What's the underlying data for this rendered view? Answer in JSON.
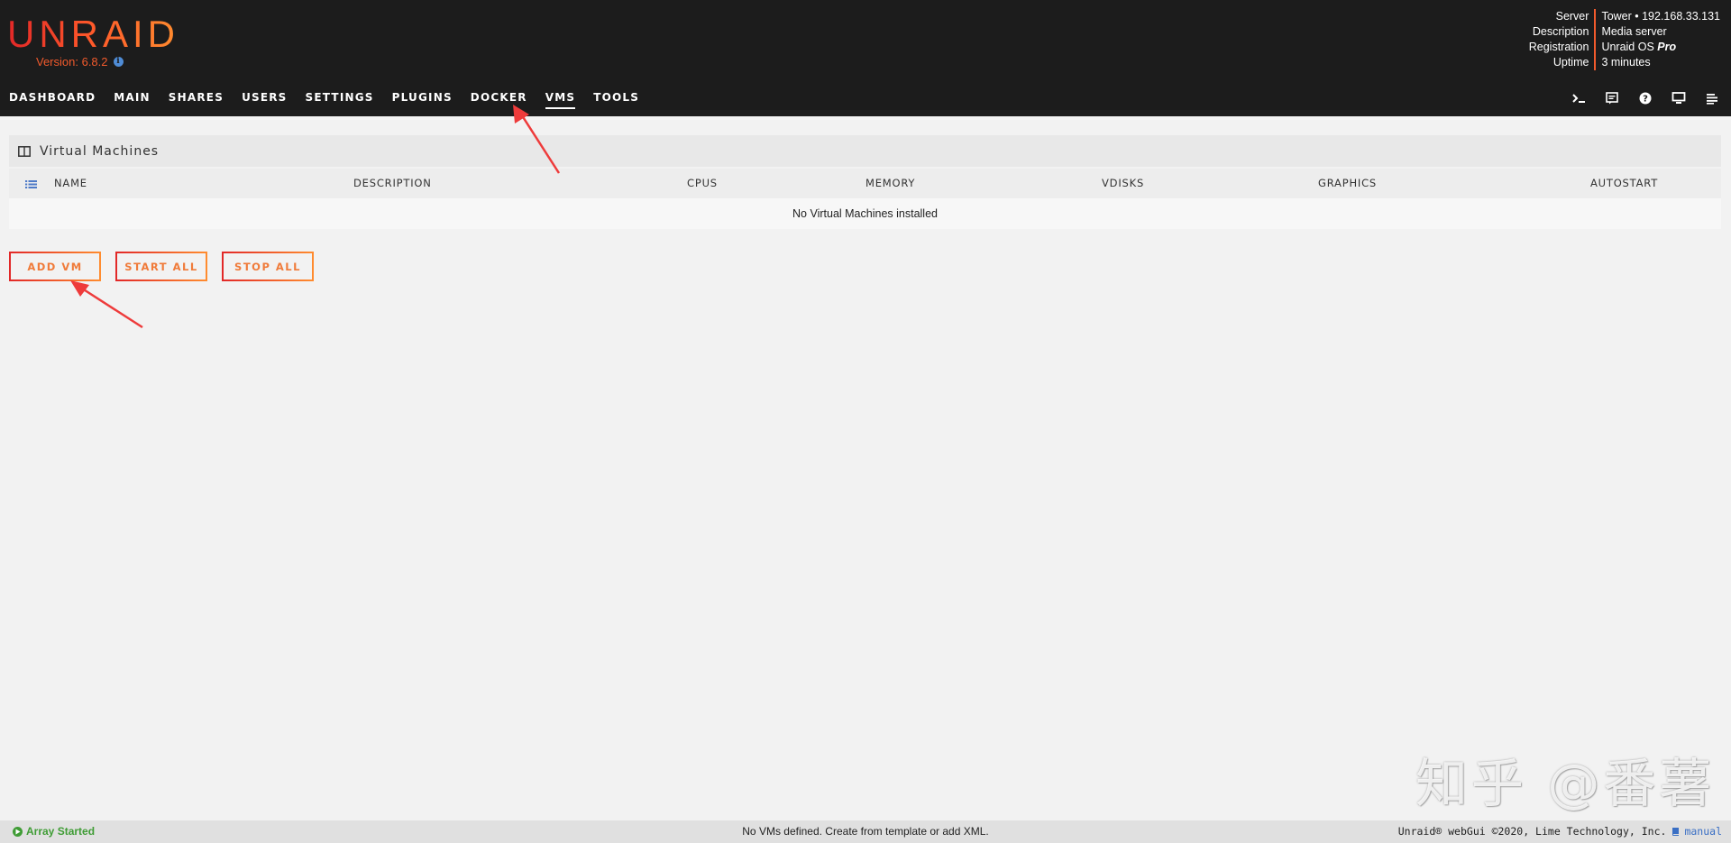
{
  "header": {
    "logo": "UNRAID",
    "version": "Version: 6.8.2",
    "server_info": [
      {
        "label": "Server",
        "value": "Tower • 192.168.33.131"
      },
      {
        "label": "Description",
        "value": "Media server"
      },
      {
        "label": "Registration",
        "value_plain": "Unraid OS ",
        "value_em": "Pro"
      },
      {
        "label": "Uptime",
        "value": "3 minutes"
      }
    ],
    "nav": [
      {
        "label": "DASHBOARD"
      },
      {
        "label": "MAIN"
      },
      {
        "label": "SHARES"
      },
      {
        "label": "USERS"
      },
      {
        "label": "SETTINGS"
      },
      {
        "label": "PLUGINS"
      },
      {
        "label": "DOCKER"
      },
      {
        "label": "VMS",
        "active": true
      },
      {
        "label": "TOOLS"
      }
    ],
    "nav_icons": [
      "terminal-icon",
      "log-icon",
      "help-icon",
      "display-icon",
      "menu-lines-icon"
    ]
  },
  "panel": {
    "title": "Virtual Machines",
    "columns": [
      "NAME",
      "DESCRIPTION",
      "CPUS",
      "MEMORY",
      "VDISKS",
      "GRAPHICS",
      "AUTOSTART"
    ],
    "empty_message": "No Virtual Machines installed"
  },
  "buttons": {
    "add_vm": "ADD VM",
    "start_all": "START ALL",
    "stop_all": "STOP ALL"
  },
  "watermark": "知乎 @番薯",
  "footer": {
    "status": "Array Started",
    "message": "No VMs defined. Create from template or add XML.",
    "copyright": "Unraid® webGui ©2020, Lime Technology, Inc.",
    "manual": "manual"
  },
  "colors": {
    "header_bg": "#1c1c1c",
    "accent": "#f15a2c",
    "page_bg": "#f2f2f2",
    "status_green": "#3f9c35",
    "link_blue": "#3a6fc4"
  }
}
